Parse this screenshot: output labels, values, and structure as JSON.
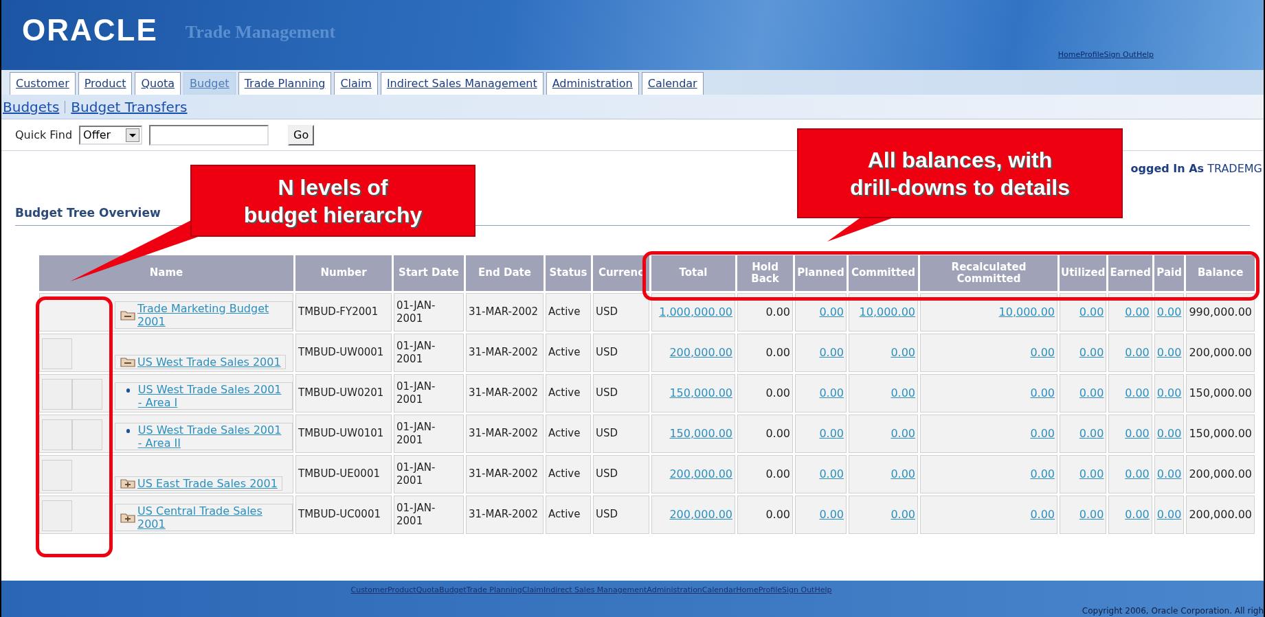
{
  "header": {
    "logo": "ORACLE",
    "app_title": "Trade Management",
    "links": [
      "Home",
      "Profile",
      "Sign Out",
      "Help"
    ]
  },
  "tabs": [
    {
      "label": "Customer",
      "selected": false
    },
    {
      "label": "Product",
      "selected": false
    },
    {
      "label": "Quota",
      "selected": false
    },
    {
      "label": "Budget",
      "selected": true
    },
    {
      "label": "Trade Planning",
      "selected": false
    },
    {
      "label": "Claim",
      "selected": false
    },
    {
      "label": "Indirect Sales Management",
      "selected": false
    },
    {
      "label": "Administration",
      "selected": false
    },
    {
      "label": "Calendar",
      "selected": false
    }
  ],
  "subnav": [
    "Budgets",
    "Budget Transfers"
  ],
  "quick_find": {
    "label": "Quick Find",
    "select_value": "Offer",
    "button": "Go"
  },
  "login": {
    "label": "ogged In As",
    "user": "TRADEMG"
  },
  "section_title": "Budget Tree Overview",
  "table": {
    "columns": [
      {
        "label": "Name",
        "link": true
      },
      {
        "label": "Number",
        "link": false
      },
      {
        "label": "Start Date",
        "link": false
      },
      {
        "label": "End Date",
        "link": false
      },
      {
        "label": "Status",
        "link": false
      },
      {
        "label": "Currenc",
        "link": false
      },
      {
        "label": "Total",
        "link": true
      },
      {
        "label": "Hold Back",
        "link": false
      },
      {
        "label": "Planned",
        "link": true
      },
      {
        "label": "Committed",
        "link": true
      },
      {
        "label": "Recalculated Committed",
        "link": true
      },
      {
        "label": "Utilized",
        "link": true
      },
      {
        "label": "Earned",
        "link": true
      },
      {
        "label": "Paid",
        "link": true
      },
      {
        "label": "Balance",
        "link": false
      }
    ],
    "rows": [
      {
        "kind": "folder",
        "expanded": true,
        "cells": [
          "Trade Marketing Budget 2001",
          "TMBUD-FY2001",
          "01-JAN-2001",
          "31-MAR-2002",
          "Active",
          "USD",
          "1,000,000.00",
          "0.00",
          "0.00",
          "10,000.00",
          "10,000.00",
          "0.00",
          "0.00",
          "0.00",
          "990,000.00"
        ],
        "children": [
          {
            "kind": "folder",
            "expanded": true,
            "cells": [
              "US West Trade Sales 2001",
              "TMBUD-UW0001",
              "01-JAN-2001",
              "31-MAR-2002",
              "Active",
              "USD",
              "200,000.00",
              "0.00",
              "0.00",
              "0.00",
              "0.00",
              "0.00",
              "0.00",
              "0.00",
              "200,000.00"
            ],
            "children": [
              {
                "kind": "leaf",
                "cells": [
                  "US West Trade Sales 2001 - Area I",
                  "TMBUD-UW0201",
                  "01-JAN-2001",
                  "31-MAR-2002",
                  "Active",
                  "USD",
                  "150,000.00",
                  "0.00",
                  "0.00",
                  "0.00",
                  "0.00",
                  "0.00",
                  "0.00",
                  "0.00",
                  "150,000.00"
                ]
              },
              {
                "kind": "leaf",
                "cells": [
                  "US West Trade Sales 2001 - Area II",
                  "TMBUD-UW0101",
                  "01-JAN-2001",
                  "31-MAR-2002",
                  "Active",
                  "USD",
                  "150,000.00",
                  "0.00",
                  "0.00",
                  "0.00",
                  "0.00",
                  "0.00",
                  "0.00",
                  "0.00",
                  "150,000.00"
                ]
              }
            ]
          },
          {
            "kind": "folder",
            "expanded": false,
            "cells": [
              "US East Trade Sales 2001",
              "TMBUD-UE0001",
              "01-JAN-2001",
              "31-MAR-2002",
              "Active",
              "USD",
              "200,000.00",
              "0.00",
              "0.00",
              "0.00",
              "0.00",
              "0.00",
              "0.00",
              "0.00",
              "200,000.00"
            ]
          },
          {
            "kind": "folder",
            "expanded": false,
            "cells": [
              "US Central Trade Sales 2001",
              "TMBUD-UC0001",
              "01-JAN-2001",
              "31-MAR-2002",
              "Active",
              "USD",
              "200,000.00",
              "0.00",
              "0.00",
              "0.00",
              "0.00",
              "0.00",
              "0.00",
              "0.00",
              "200,000.00"
            ]
          }
        ]
      }
    ]
  },
  "footer": {
    "links": [
      "Customer",
      "Product",
      "Quota",
      "Budget",
      "Trade Planning",
      "Claim",
      "Indirect Sales Management",
      "Administration",
      "Calendar",
      "Home",
      "Profile",
      "Sign Out",
      "Help"
    ],
    "copyright": "Copyright 2006, Oracle Corporation. All righ"
  },
  "callouts": [
    {
      "lines": [
        "N levels of",
        "budget hierarchy"
      ]
    },
    {
      "lines": [
        "All balances, with",
        "drill-downs to details"
      ]
    }
  ]
}
